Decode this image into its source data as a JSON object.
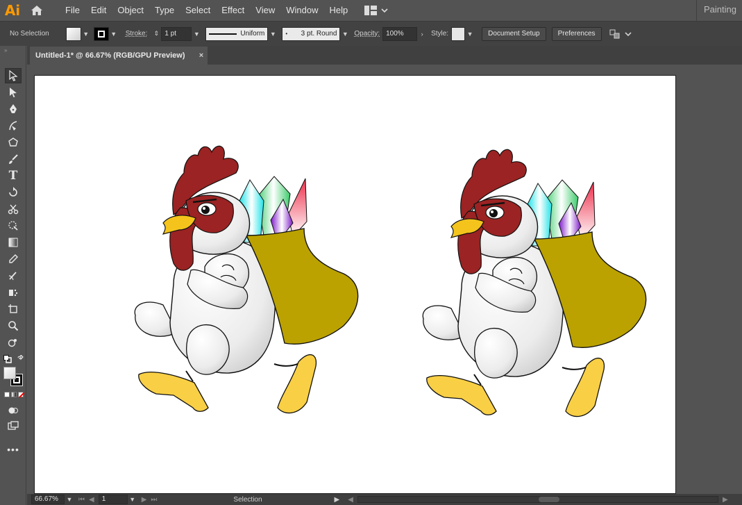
{
  "app": {
    "logo": "Ai",
    "workspace": "Painting"
  },
  "menu": [
    "File",
    "Edit",
    "Object",
    "Type",
    "Select",
    "Effect",
    "View",
    "Window",
    "Help"
  ],
  "control": {
    "selection": "No Selection",
    "stroke_label": "Stroke:",
    "stroke_weight": "1 pt",
    "stroke_profile": "Uniform",
    "brush": "3 pt. Round",
    "opacity_label": "Opacity:",
    "opacity_value": "100%",
    "style_label": "Style:",
    "document_setup": "Document Setup",
    "preferences": "Preferences"
  },
  "document": {
    "tab_title": "Untitled-1* @ 66.67% (RGB/GPU Preview)",
    "close": "×"
  },
  "status": {
    "zoom": "66.67%",
    "artboard": "1",
    "tool": "Selection"
  },
  "colors": {
    "comb": "#9b2323",
    "beak": "#f4c41c",
    "bag": "#bba200",
    "feet": "#f9cf45"
  },
  "icons": {
    "home": "home-icon",
    "workspace": "workspace-switcher-icon",
    "arrange": "arrange-documents-icon"
  }
}
